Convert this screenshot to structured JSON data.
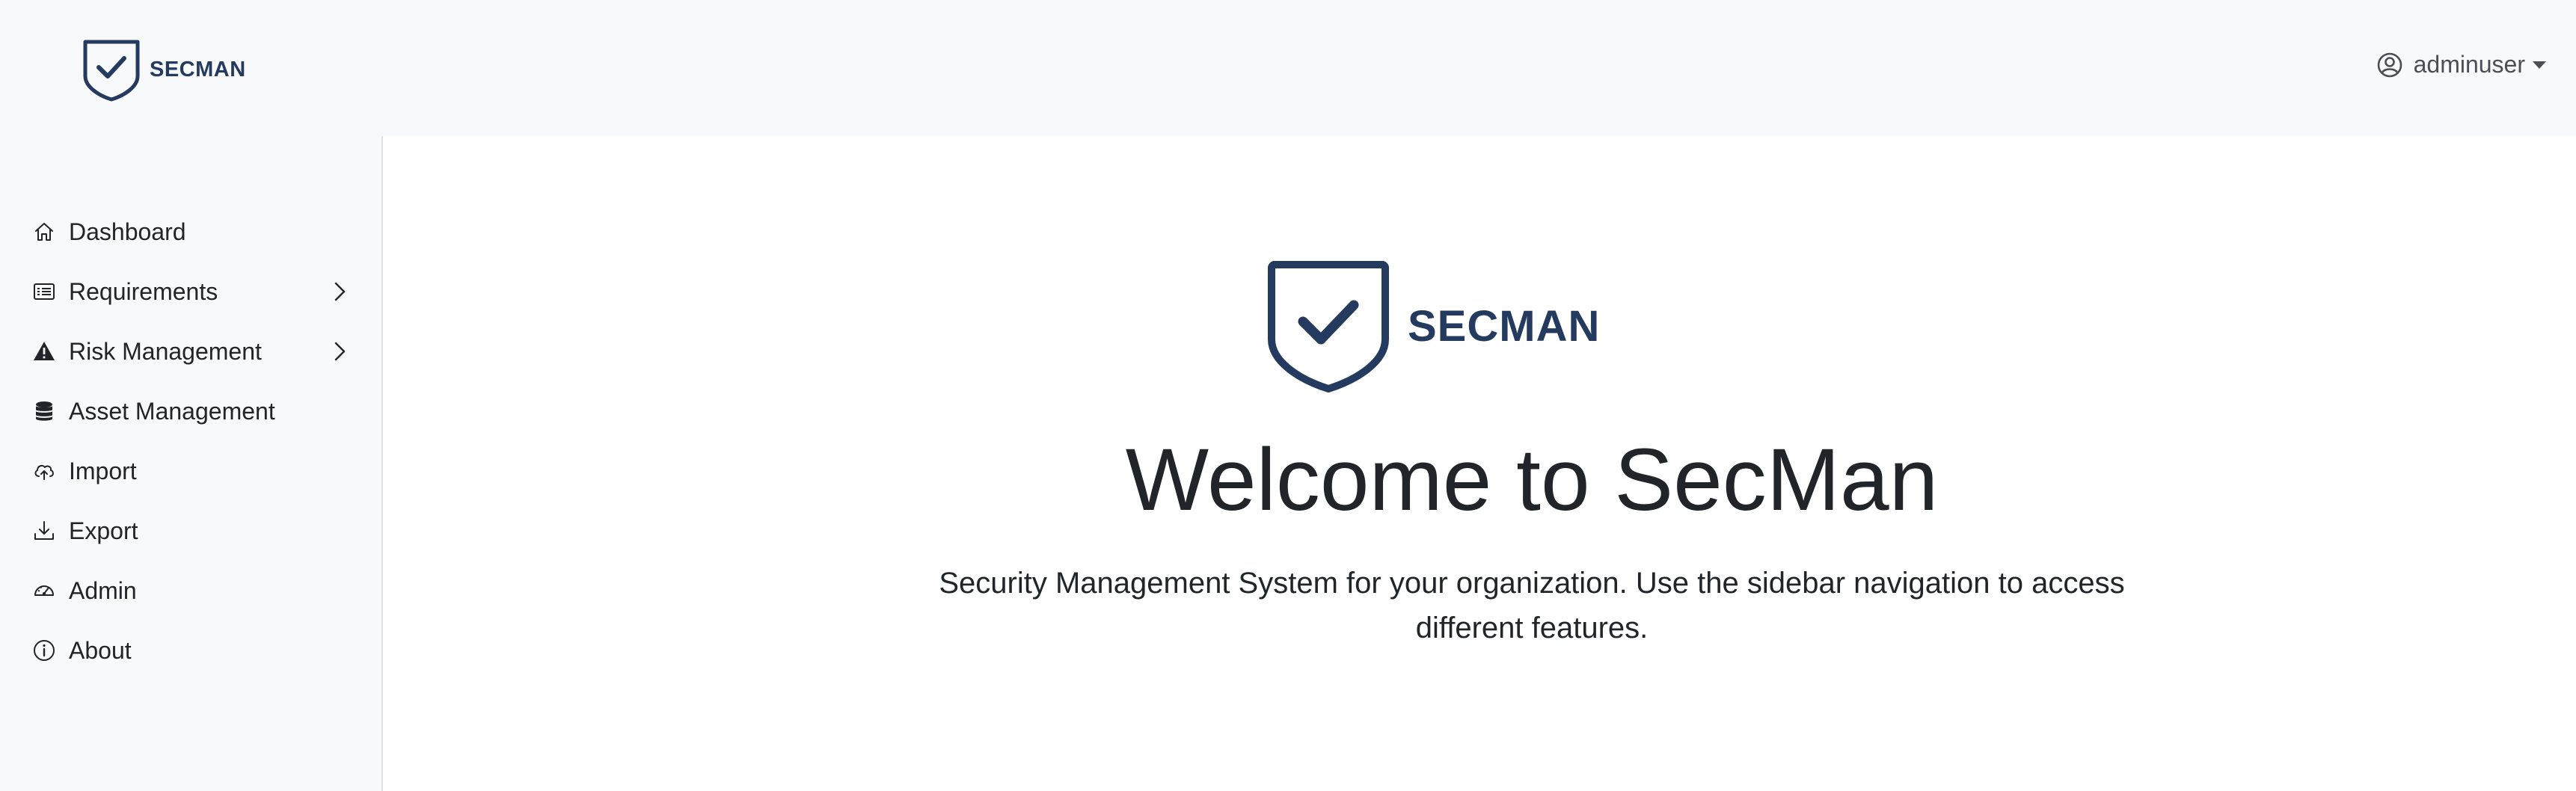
{
  "navbar": {
    "brand": "SECMAN",
    "user": "adminuser"
  },
  "sidebar": {
    "items": [
      {
        "label": "Dashboard",
        "icon": "home-icon",
        "expandable": false
      },
      {
        "label": "Requirements",
        "icon": "list-card-icon",
        "expandable": true
      },
      {
        "label": "Risk Management",
        "icon": "warning-triangle-icon",
        "expandable": true
      },
      {
        "label": "Asset Management",
        "icon": "database-icon",
        "expandable": false
      },
      {
        "label": "Import",
        "icon": "cloud-upload-icon",
        "expandable": false
      },
      {
        "label": "Export",
        "icon": "download-icon",
        "expandable": false
      },
      {
        "label": "Admin",
        "icon": "speedometer-icon",
        "expandable": false
      },
      {
        "label": "About",
        "icon": "info-circle-icon",
        "expandable": false
      }
    ]
  },
  "main": {
    "logo_text": "SECMAN",
    "title": "Welcome to SecMan",
    "subtitle": "Security Management System for your organization. Use the sidebar navigation to access different features."
  },
  "colors": {
    "brand": "#243a5e",
    "navbar_bg": "#f8f9fa",
    "text": "#212529"
  }
}
